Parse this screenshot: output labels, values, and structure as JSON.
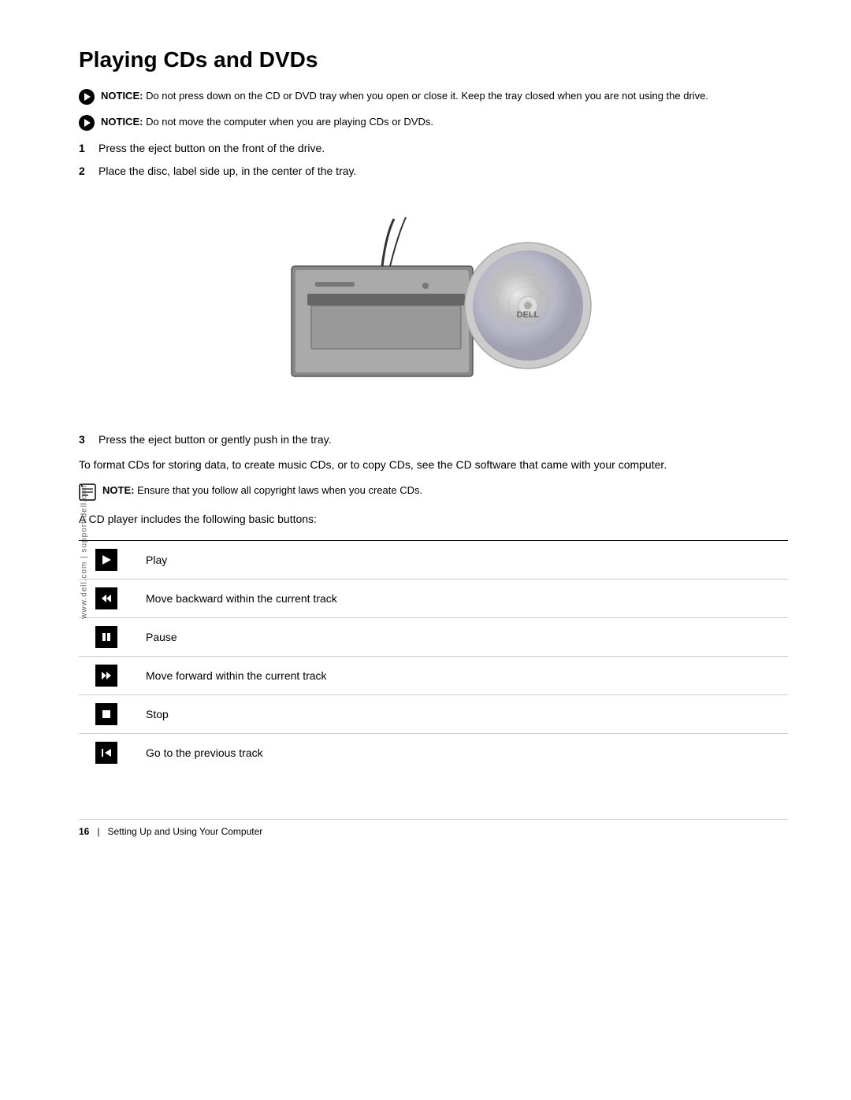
{
  "page": {
    "side_watermark": "www.dell.com | support.dell.com",
    "title": "Playing CDs and DVDs",
    "notices": [
      {
        "id": "notice-1",
        "label": "NOTICE:",
        "text": "Do not press down on the CD or DVD tray when you open or close it. Keep the tray closed when you are not using the drive."
      },
      {
        "id": "notice-2",
        "label": "NOTICE:",
        "text": "Do not move the computer when you are playing CDs or DVDs."
      }
    ],
    "steps": [
      {
        "num": "1",
        "text": "Press the eject button on the front of the drive."
      },
      {
        "num": "2",
        "text": "Place the disc, label side up, in the center of the tray."
      },
      {
        "num": "3",
        "text": "Press the eject button or gently push in the tray."
      }
    ],
    "paragraph_1": "To format CDs for storing data, to create music CDs, or to copy CDs, see the CD software that came with your computer.",
    "note": {
      "label": "NOTE:",
      "text": "Ensure that you follow all copyright laws when you create CDs."
    },
    "paragraph_2": "A CD player includes the following basic buttons:",
    "buttons_table": [
      {
        "icon_type": "play",
        "label": "Play"
      },
      {
        "icon_type": "rewind",
        "label": "Move backward within the current track"
      },
      {
        "icon_type": "pause",
        "label": "Pause"
      },
      {
        "icon_type": "fast-forward",
        "label": "Move forward within the current track"
      },
      {
        "icon_type": "stop",
        "label": "Stop"
      },
      {
        "icon_type": "prev-track",
        "label": "Go to the previous track"
      }
    ],
    "footer": {
      "page_num": "16",
      "separator": "|",
      "label": "Setting Up and Using Your Computer"
    }
  }
}
